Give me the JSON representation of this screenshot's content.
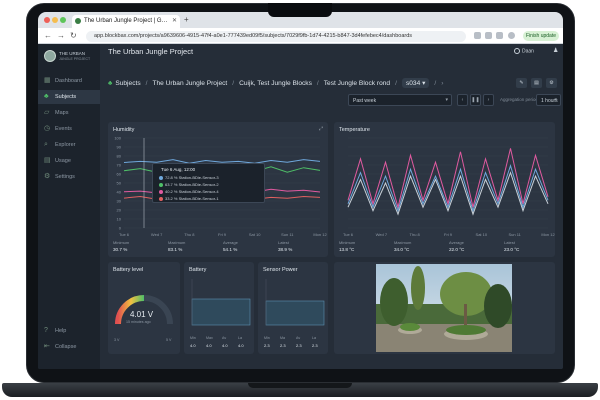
{
  "browser": {
    "tab_title": "The Urban Jungle Project | G…",
    "url": "app.blockbax.com/projects/a9639606-4915-47f4-a0e1-777439ed09f5/subjects/7029f9fb-1d74-4215-b847-3d4fefebec4/dashboards",
    "finish_update_label": "Finish update"
  },
  "sidebar": {
    "brand_line1": "THE URBAN",
    "brand_line2": "JUNGLE PROJECT",
    "items": [
      {
        "label": "Dashboard",
        "icon": "dashboard-icon"
      },
      {
        "label": "Subjects",
        "icon": "subjects-icon",
        "active": true
      },
      {
        "label": "Maps",
        "icon": "map-icon"
      },
      {
        "label": "Events",
        "icon": "events-icon"
      },
      {
        "label": "Explorer",
        "icon": "explorer-icon"
      },
      {
        "label": "Usage",
        "icon": "usage-icon"
      },
      {
        "label": "Settings",
        "icon": "gear-icon"
      }
    ],
    "footer": [
      {
        "label": "Help",
        "icon": "help-icon"
      },
      {
        "label": "Collapse",
        "icon": "collapse-icon"
      }
    ]
  },
  "header": {
    "title": "The Urban Jungle Project",
    "user": "Daan"
  },
  "breadcrumbs": [
    "Subjects",
    "The Urban Jungle Project",
    "Cuijk, Test Jungle Blocks",
    "Test Jungle Block rond",
    "s034"
  ],
  "controls": {
    "period": "Past week",
    "aggregation_label": "Aggregation period",
    "aggregation": "1 hours"
  },
  "humidity": {
    "title": "Humidity",
    "tooltip_title": "Tue 6 Aug, 12:00",
    "tooltip_rows": [
      {
        "text": "72.8 % Station-BDie-Sensor-3",
        "color": "#6fa8dc"
      },
      {
        "text": "63.7 % Station-BDie-Sensor-2",
        "color": "#4fbf68"
      },
      {
        "text": "40.2 % Station-BDie-Sensor-4",
        "color": "#e05aa0"
      },
      {
        "text": "33.2 % Station-BDie-Sensor-1",
        "color": "#e06060"
      }
    ],
    "stats": [
      {
        "label": "Minimum",
        "value": "30.7 %"
      },
      {
        "label": "Maximum",
        "value": "83.1 %"
      },
      {
        "label": "Average",
        "value": "54.1 %"
      },
      {
        "label": "Latest",
        "value": "38.9 %"
      }
    ]
  },
  "temperature": {
    "title": "Temperature",
    "stats": [
      {
        "label": "Minimum",
        "value": "13.8 °C"
      },
      {
        "label": "Maximum",
        "value": "34.0 °C"
      },
      {
        "label": "Average",
        "value": "22.0 °C"
      },
      {
        "label": "Latest",
        "value": "23.0 °C"
      }
    ]
  },
  "battery_level": {
    "title": "Battery level",
    "value": "4.01 V",
    "sub": "15 minutes ago",
    "min": "3 V",
    "max": "5 V",
    "fraction": 0.5
  },
  "battery": {
    "title": "Battery",
    "labels": [
      "Min",
      "Max",
      "Av",
      "La"
    ],
    "values": [
      "4.0",
      "4.0",
      "4.0",
      "4.0"
    ]
  },
  "sensor_power": {
    "title": "Sensor Power",
    "labels": [
      "Min",
      "Ma",
      "Av",
      "La"
    ],
    "values": [
      "2.3",
      "2.3",
      "2.3",
      "2.3"
    ]
  },
  "chart_data": [
    {
      "type": "line",
      "title": "Humidity",
      "x": [
        "Tue 6",
        "Wed 7",
        "Thu 8",
        "Fri 9",
        "Sat 10",
        "Sun 11",
        "Mon 12"
      ],
      "ylim": [
        0,
        100
      ],
      "yticks": [
        "100",
        "90",
        "80",
        "70",
        "60",
        "50",
        "40",
        "30",
        "20",
        "10",
        "0"
      ],
      "series": [
        {
          "color": "#6fa8dc",
          "values": [
            72.8,
            74,
            73,
            76,
            72,
            75,
            73,
            74,
            72,
            75,
            73,
            76,
            74
          ]
        },
        {
          "color": "#4fbf68",
          "values": [
            63.7,
            66,
            62,
            68,
            63,
            67,
            62,
            66,
            63,
            68,
            62,
            67,
            64
          ]
        },
        {
          "color": "#e05aa0",
          "values": [
            40.2,
            41,
            39,
            42,
            40,
            41,
            39,
            42,
            40,
            43,
            41,
            42,
            40
          ]
        },
        {
          "color": "#e06060",
          "values": [
            33.2,
            35,
            32,
            34,
            33,
            36,
            33,
            35,
            32,
            34,
            33,
            35,
            34
          ]
        }
      ]
    },
    {
      "type": "line",
      "title": "Temperature",
      "x": [
        "Tue 6",
        "Wed 7",
        "Thu 8",
        "Fri 9",
        "Sat 10",
        "Sun 11",
        "Mon 12"
      ],
      "ylim": [
        10,
        36
      ],
      "series": [
        {
          "color": "#e05aa0",
          "values": [
            18,
            30,
            17,
            29,
            16,
            31,
            18,
            29,
            17,
            32,
            16,
            30,
            18,
            33,
            17,
            31,
            19
          ]
        },
        {
          "color": "#6fa8dc",
          "values": [
            17,
            26,
            16,
            25,
            15,
            27,
            17,
            25,
            16,
            27,
            15,
            26,
            17,
            28,
            16,
            27,
            18
          ]
        },
        {
          "color": "#c9d1d9",
          "values": [
            16,
            24,
            15,
            23,
            14,
            25,
            16,
            24,
            15,
            25,
            14,
            24,
            16,
            26,
            15,
            25,
            17
          ]
        }
      ]
    }
  ],
  "colors": {
    "accent": "#4fbf68",
    "background": "#252d38",
    "card": "#2c3542"
  }
}
